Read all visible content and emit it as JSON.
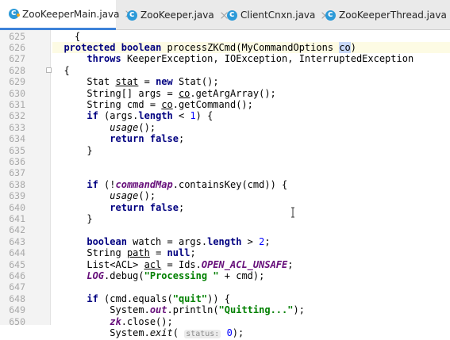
{
  "tabs": [
    {
      "label": "ZooKeeperMain.java",
      "active": true
    },
    {
      "label": "ZooKeeper.java",
      "active": false
    },
    {
      "label": "ClientCnxn.java",
      "active": false
    },
    {
      "label": "ZooKeeperThread.java",
      "active": false
    }
  ],
  "line_numbers": [
    "625",
    "626",
    "627",
    "628",
    "629",
    "630",
    "631",
    "632",
    "633",
    "634",
    "635",
    "636",
    "637",
    "638",
    "639",
    "640",
    "641",
    "642",
    "643",
    "644",
    "645",
    "646",
    "647",
    "648",
    "649",
    "650"
  ],
  "code": {
    "l626": {
      "protected": "protected",
      "boolean": "boolean",
      "sig": "processZKCmd(MyCommandOptions ",
      "co": "co",
      "close": ")"
    },
    "l627": {
      "throws": "throws",
      "rest": "KeeperException, IOException, InterruptedException"
    },
    "l628": "{",
    "l629": {
      "type": "Stat ",
      "var": "stat",
      "eq": " = ",
      "new": "new",
      "rest": " Stat();"
    },
    "l630": {
      "a": "String[] args = ",
      "co": "co",
      "b": ".getArgArray();"
    },
    "l631": {
      "a": "String cmd = ",
      "co": "co",
      "b": ".getCommand();"
    },
    "l632": {
      "if": "if",
      "a": " (args.",
      "length": "length",
      "b": " < ",
      "num": "1",
      "c": ") {"
    },
    "l633": {
      "usage": "usage",
      "rest": "();"
    },
    "l634": {
      "return": "return",
      "false": "false",
      "semi": ";"
    },
    "l635": "}",
    "l637": {
      "if": "if",
      "a": " (!",
      "map": "commandMap",
      "b": ".containsKey(cmd)) {"
    },
    "l638": {
      "usage": "usage",
      "rest": "();"
    },
    "l639": {
      "return": "return",
      "false": "false",
      "semi": ";"
    },
    "l640": "}",
    "l642": {
      "boolean": "boolean",
      "a": " watch = args.",
      "length": "length",
      "b": " > ",
      "num": "2",
      "c": ";"
    },
    "l643": {
      "a": "String ",
      "var": "path",
      "b": " = ",
      "null": "null",
      "c": ";"
    },
    "l644": {
      "a": "List<ACL> ",
      "var": "acl",
      "b": " = Ids.",
      "const": "OPEN_ACL_UNSAFE",
      "c": ";"
    },
    "l645": {
      "log": "LOG",
      "a": ".debug(",
      "str": "\"Processing \"",
      "b": " + cmd);"
    },
    "l647": {
      "if": "if",
      "a": " (cmd.equals(",
      "str": "\"quit\"",
      "b": ")) {"
    },
    "l648": {
      "a": "System.",
      "out": "out",
      "b": ".println(",
      "str": "\"Quitting...\"",
      "c": ");"
    },
    "l649": {
      "zk": "zk",
      "rest": ".close();"
    },
    "l650": {
      "a": "System.",
      "exit": "exit",
      "b": "( ",
      "hint": "status:",
      "num": " 0",
      "c": ");"
    }
  },
  "colors": {
    "keyword": "#000080",
    "string": "#008000",
    "number": "#0000ff",
    "field": "#660e7a",
    "tab_accent": "#3d82d9"
  }
}
